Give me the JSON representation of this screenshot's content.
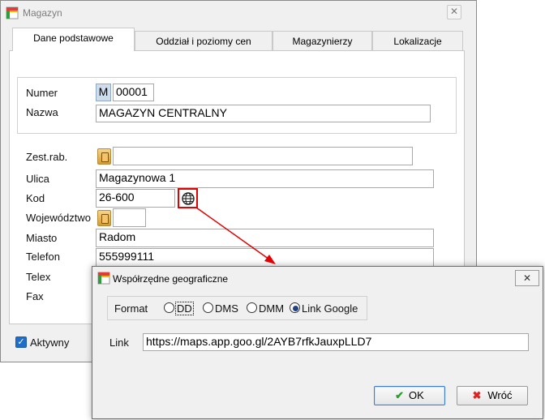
{
  "main_window": {
    "title": "Magazyn",
    "close_glyph": "✕",
    "tabs": [
      {
        "label": "Dane podstawowe",
        "active": true
      },
      {
        "label": "Oddział i poziomy cen",
        "active": false
      },
      {
        "label": "Magazynierzy",
        "active": false
      },
      {
        "label": "Lokalizacje",
        "active": false
      }
    ],
    "numer": {
      "label": "Numer",
      "prefix": "M",
      "value": "00001"
    },
    "nazwa": {
      "label": "Nazwa",
      "value": "MAGAZYN CENTRALNY"
    },
    "zest_rab": {
      "label": "Zest.rab.",
      "value": ""
    },
    "ulica": {
      "label": "Ulica",
      "value": "Magazynowa 1"
    },
    "kod": {
      "label": "Kod",
      "value": "26-600"
    },
    "wojewodztwo": {
      "label": "Województwo",
      "value": ""
    },
    "miasto": {
      "label": "Miasto",
      "value": "Radom"
    },
    "telefon": {
      "label": "Telefon",
      "value": "555999111"
    },
    "telex": {
      "label": "Telex"
    },
    "fax": {
      "label": "Fax"
    },
    "aktywny": {
      "label": "Aktywny",
      "checked": true,
      "check_glyph": "✓"
    }
  },
  "dialog": {
    "title": "Współrzędne geograficzne",
    "close_glyph": "✕",
    "format_label": "Format",
    "format_options": [
      {
        "label": "DD",
        "selected": false
      },
      {
        "label": "DMS",
        "selected": false
      },
      {
        "label": "DMM",
        "selected": false
      },
      {
        "label": "Link Google",
        "selected": true
      }
    ],
    "link_label": "Link",
    "link_value": "https://maps.app.goo.gl/2AYB7rfkJauxpLLD7",
    "ok_label": "OK",
    "ok_icon_glyph": "✔",
    "cancel_label": "Wróć",
    "cancel_icon_glyph": "✖"
  },
  "colors": {
    "highlight_red": "#e30000",
    "prefix_blue": "#cfdceb",
    "checkbox_blue": "#1f6fc9"
  },
  "icons": {
    "app": "app-icon",
    "picker": "book-icon",
    "globe": "globe-icon",
    "ok": "check-icon",
    "cancel": "x-icon"
  }
}
